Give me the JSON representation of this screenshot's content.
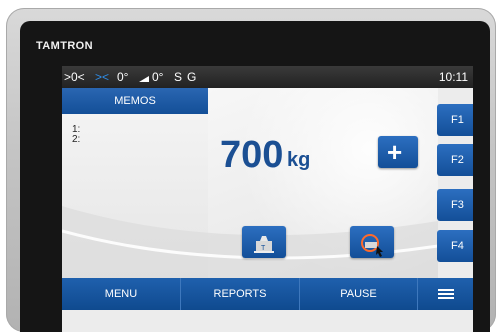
{
  "brand": "TAMTRON",
  "status_bar": {
    "zero_indicator": ">0<",
    "center_zero": "><",
    "tilt_1": "0°",
    "tilt_2": "0°",
    "stable": "S",
    "gross": "G",
    "time": "10:11"
  },
  "memos": {
    "header": "MEMOS",
    "lines": [
      "1:",
      "2:"
    ]
  },
  "weight": {
    "value": "700",
    "unit": "kg"
  },
  "plus_button": {
    "label": "+"
  },
  "function_keys": [
    "F1",
    "F2",
    "F3",
    "F4"
  ],
  "bottom_menu": {
    "menu": "MENU",
    "reports": "REPORTS",
    "pause": "PAUSE"
  },
  "icons": {
    "tare": "tare-weight-icon",
    "zero": "zero-scale-icon",
    "hamburger": "hamburger-menu-icon",
    "cursor": "mouse-cursor-icon"
  },
  "colors": {
    "accent_blue": "#134f98",
    "status_blue": "#2f8fea",
    "weight_text": "#1b4f93"
  }
}
